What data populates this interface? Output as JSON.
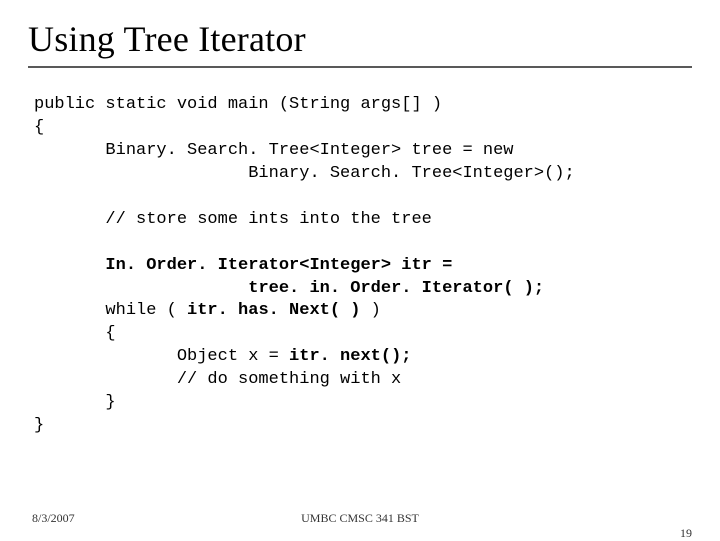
{
  "title": "Using Tree Iterator",
  "code": {
    "l1": "public static void main (String args[] )",
    "l2": "{",
    "l3": "       Binary. Search. Tree<Integer> tree = new",
    "l4": "                     Binary. Search. Tree<Integer>();",
    "blank1": "",
    "l5": "       // store some ints into the tree",
    "blank2": "",
    "l6a": "       ",
    "l6b": "In. Order. Iterator<Integer> itr =",
    "l7a": "                     ",
    "l7b": "tree. in. Order. Iterator( );",
    "l8": "       while ( ",
    "l8b": "itr. has. Next( )",
    "l8c": " )",
    "l9": "       {",
    "l10": "              Object x = ",
    "l10b": "itr. next();",
    "l11": "              // do something with x",
    "l12": "       }",
    "l13": "}"
  },
  "footer": {
    "date": "8/3/2007",
    "center": "UMBC CMSC 341 BST",
    "page": "19"
  }
}
